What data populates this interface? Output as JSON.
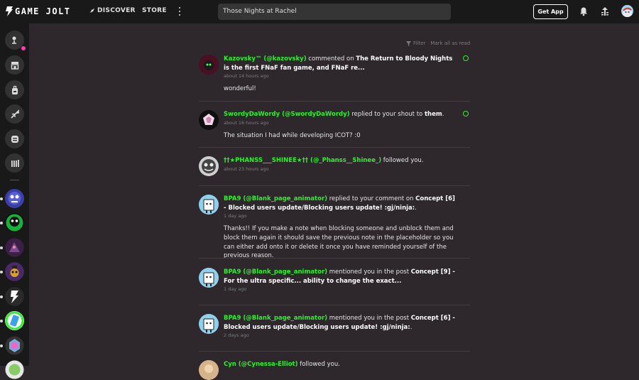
{
  "header": {
    "logo_text": "GAME JOLT",
    "nav_discover": "DISCOVER",
    "nav_store": "STORE",
    "search_value": "Those Nights at Rachel",
    "get_app": "Get App"
  },
  "feed_controls": {
    "filter": "Filter",
    "mark_all_read": "Mark all as read"
  },
  "notifications": [
    {
      "who": "Kazovsky™ (@kazovsky)",
      "action": " commented on ",
      "target": "The Return to Bloody Nights is the first FNaF fan game, and FNaF re...",
      "time": "about 14 hours ago",
      "message": "wonderful!",
      "unread": true
    },
    {
      "who": "SwordyDaWordy (@SwordyDaWordy)",
      "action": " replied to your shout to ",
      "target": "them",
      "tail": ".",
      "time": "about 16 hours ago",
      "message": "The situation I had while developing ICOT? :0",
      "unread": true
    },
    {
      "who": "††★PHANSS___SHINEE★†† (@_Phanss__Shinee_)",
      "action": " followed you.",
      "time": "about 23 hours ago"
    },
    {
      "who": "BPA9 (@Blank_page_animator)",
      "action": " replied to your comment on ",
      "target": "Concept [6] - Blocked users update/Blocking users update! :gj/ninja:",
      "tail": ".",
      "time": "1 day ago",
      "message": "Thanks!! If you make a note when blocking someone and unblock them and block them again it should save the previous note in the placeholder so you can either add onto it or delete it once you have reminded yourself of the previous reason."
    },
    {
      "who": "BPA9 (@Blank_page_animator)",
      "action": " mentioned you in the post ",
      "target": "Concept [9] - For the ultra specific... ability to change the exact...",
      "time": "1 day ago"
    },
    {
      "who": "BPA9 (@Blank_page_animator)",
      "action": " mentioned you in the post ",
      "target": "Concept [6] - Blocked users update/Blocking users update! :gj/ninja:",
      "tail": ".",
      "time": "2 days ago"
    },
    {
      "who": "Cyn (@Cynessa-Elliot)",
      "action": " followed you."
    }
  ],
  "colors": {
    "accent_green": "#2cf22c",
    "notification_pink": "#ff3fac",
    "background": "#2e282c",
    "chrome": "#191919"
  }
}
